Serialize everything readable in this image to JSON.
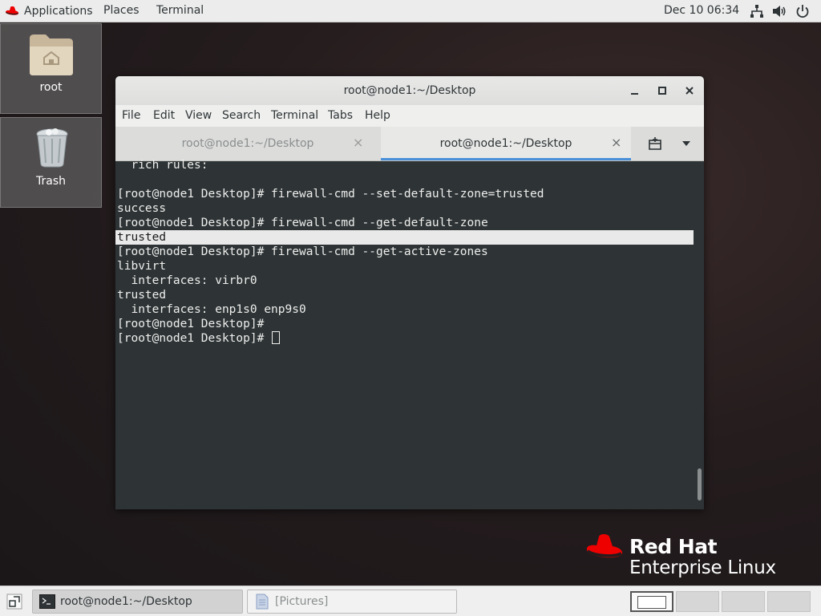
{
  "topbar": {
    "applications": "Applications",
    "places": "Places",
    "terminal": "Terminal",
    "clock": "Dec 10  06:34",
    "icons": [
      "network-icon",
      "volume-icon",
      "power-icon"
    ]
  },
  "desktop": {
    "icons": [
      {
        "label": "root",
        "icon": "home-folder-icon"
      },
      {
        "label": "Trash",
        "icon": "trash-icon"
      }
    ]
  },
  "window": {
    "title": "root@node1:~/Desktop",
    "menu": [
      "File",
      "Edit",
      "View",
      "Search",
      "Terminal",
      "Tabs",
      "Help"
    ],
    "tabs": [
      {
        "label": "root@node1:~/Desktop",
        "active": false
      },
      {
        "label": "root@node1:~/Desktop",
        "active": true
      }
    ],
    "terminal_lines": [
      "  rich rules:",
      "",
      "[root@node1 Desktop]# firewall-cmd --set-default-zone=trusted",
      "success",
      "[root@node1 Desktop]# firewall-cmd --get-default-zone",
      "trusted",
      "[root@node1 Desktop]# firewall-cmd --get-active-zones",
      "libvirt",
      "  interfaces: virbr0",
      "trusted",
      "  interfaces: enp1s0 enp9s0",
      "[root@node1 Desktop]#",
      "[root@node1 Desktop]# "
    ],
    "selected_line_index": 5
  },
  "branding": {
    "line1": "Red Hat",
    "line2": "Enterprise Linux",
    "accent": "#ee0000"
  },
  "taskbar": {
    "tasks": [
      {
        "label": "root@node1:~/Desktop",
        "active": true
      },
      {
        "label": "[Pictures]",
        "active": false
      }
    ]
  }
}
